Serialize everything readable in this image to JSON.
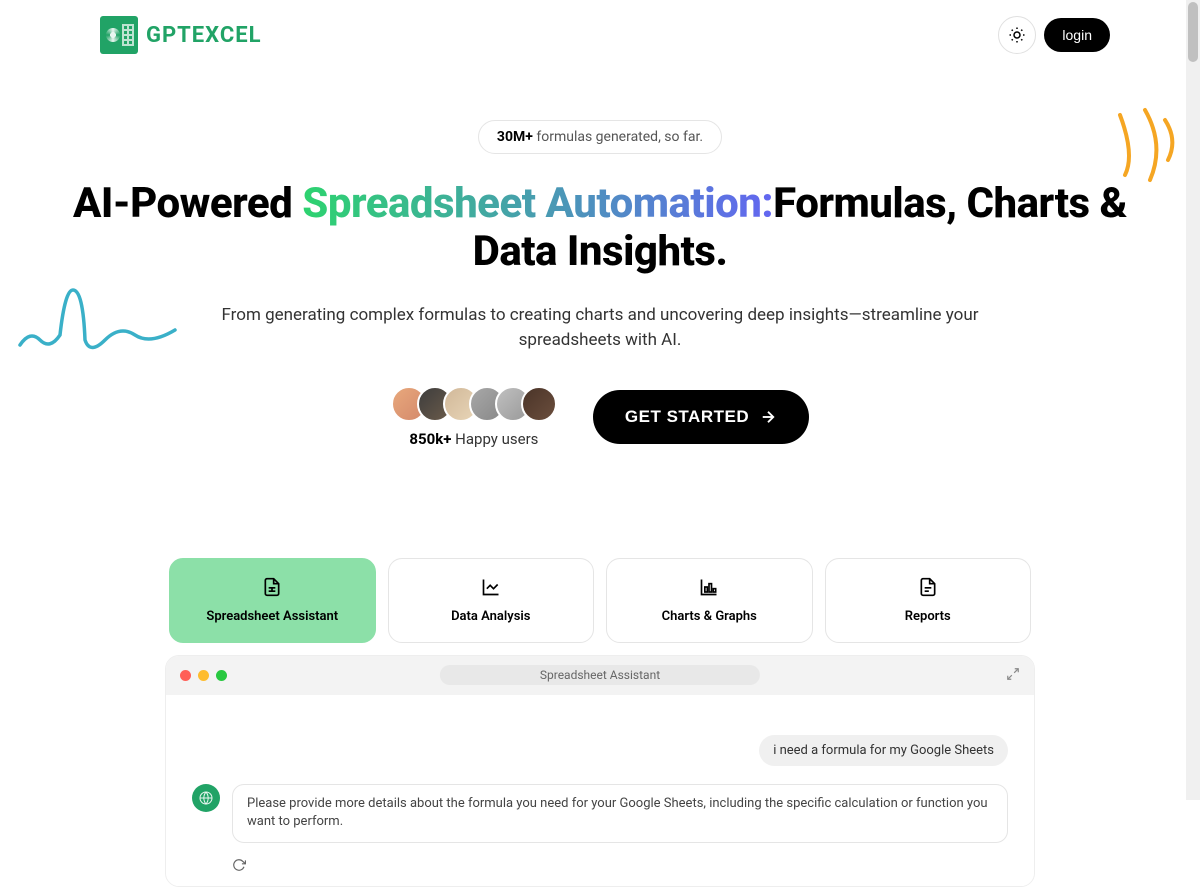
{
  "brand": {
    "name": "GPTEXCEL"
  },
  "header": {
    "login": "login"
  },
  "hero": {
    "stats_count": "30M+",
    "stats_suffix": " formulas generated, so far.",
    "h1_pre": "AI-Powered ",
    "h1_gradient": "Spreadsheet Automation:",
    "h1_post": "Formulas, Charts & Data Insights.",
    "sub": "From generating complex formulas to creating charts and uncovering deep insights—streamline your spreadsheets with AI.",
    "users_count": "850k+",
    "users_suffix": " Happy users",
    "cta": "GET STARTED"
  },
  "tabs": [
    {
      "label": "Spreadsheet Assistant",
      "icon": "file-spreadsheet",
      "active": true
    },
    {
      "label": "Data Analysis",
      "icon": "line-chart",
      "active": false
    },
    {
      "label": "Charts & Graphs",
      "icon": "bar-chart",
      "active": false
    },
    {
      "label": "Reports",
      "icon": "file-text",
      "active": false
    }
  ],
  "demo": {
    "window_title": "Spreadsheet Assistant",
    "user_message": "i need a formula for my Google Sheets",
    "assistant_message": "Please provide more details about the formula you need for your Google Sheets, including the specific calculation or function you want to perform."
  }
}
